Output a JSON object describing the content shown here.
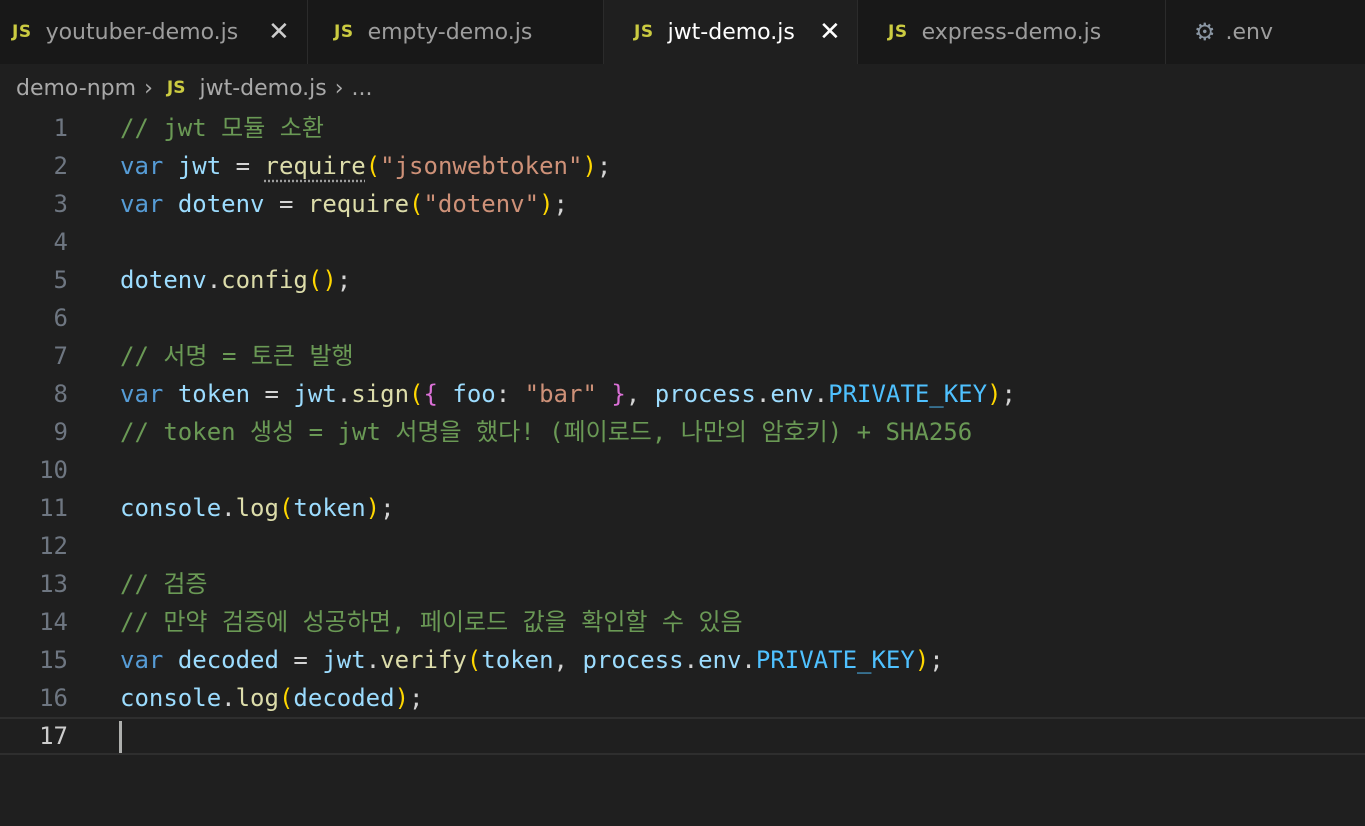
{
  "tabs": [
    {
      "icon": "JS",
      "label": "youtuber-demo.js",
      "close": "✕"
    },
    {
      "icon": "JS",
      "label": "empty-demo.js"
    },
    {
      "icon": "JS",
      "label": "jwt-demo.js",
      "close": "✕"
    },
    {
      "icon": "JS",
      "label": "express-demo.js"
    },
    {
      "icon": "gear-icon",
      "label": ".env"
    }
  ],
  "breadcrumb": {
    "folder": "demo-npm",
    "sep": "›",
    "file_icon": "JS",
    "file": "jwt-demo.js",
    "more": "..."
  },
  "editor": {
    "line_numbers": [
      "1",
      "2",
      "3",
      "4",
      "5",
      "6",
      "7",
      "8",
      "9",
      "10",
      "11",
      "12",
      "13",
      "14",
      "15",
      "16",
      "17"
    ],
    "current_line": "17",
    "lines": {
      "l1": "// jwt 모듈 소환",
      "l2": {
        "var": "var",
        "name": "jwt",
        "eq": " = ",
        "fn": "require",
        "open": "(",
        "str": "\"jsonwebtoken\"",
        "close": ")",
        "semi": ";"
      },
      "l3": {
        "var": "var",
        "name": "dotenv",
        "eq": " = ",
        "fn": "require",
        "open": "(",
        "str": "\"dotenv\"",
        "close": ")",
        "semi": ";"
      },
      "l5": {
        "obj": "dotenv",
        "dot": ".",
        "fn": "config",
        "open": "(",
        "close": ")",
        "semi": ";"
      },
      "l7": "// 서명 = 토큰 발행",
      "l8": {
        "var": "var",
        "name": "token",
        "eq": " = ",
        "obj": "jwt",
        "dot": ".",
        "fn": "sign",
        "open": "(",
        "brace_open": "{",
        "key": " foo",
        "colon": ": ",
        "str": "\"bar\"",
        "brace_close": " }",
        "comma": ", ",
        "proc": "process",
        "dot2": ".",
        "env": "env",
        "dot3": ".",
        "const": "PRIVATE_KEY",
        "close": ")",
        "semi": ";"
      },
      "l9": "// token 생성 = jwt 서명을 했다! (페이로드, 나만의 암호키) + SHA256",
      "l11": {
        "obj": "console",
        "dot": ".",
        "fn": "log",
        "open": "(",
        "arg": "token",
        "close": ")",
        "semi": ";"
      },
      "l13": "// 검증",
      "l14": "// 만약 검증에 성공하면, 페이로드 값을 확인할 수 있음",
      "l15": {
        "var": "var",
        "name": "decoded",
        "eq": " = ",
        "obj": "jwt",
        "dot": ".",
        "fn": "verify",
        "open": "(",
        "arg": "token",
        "comma": ", ",
        "proc": "process",
        "dot2": ".",
        "env": "env",
        "dot3": ".",
        "const": "PRIVATE_KEY",
        "close": ")",
        "semi": ";"
      },
      "l16": {
        "obj": "console",
        "dot": ".",
        "fn": "log",
        "open": "(",
        "arg": "decoded",
        "close": ")",
        "semi": ";"
      }
    }
  }
}
